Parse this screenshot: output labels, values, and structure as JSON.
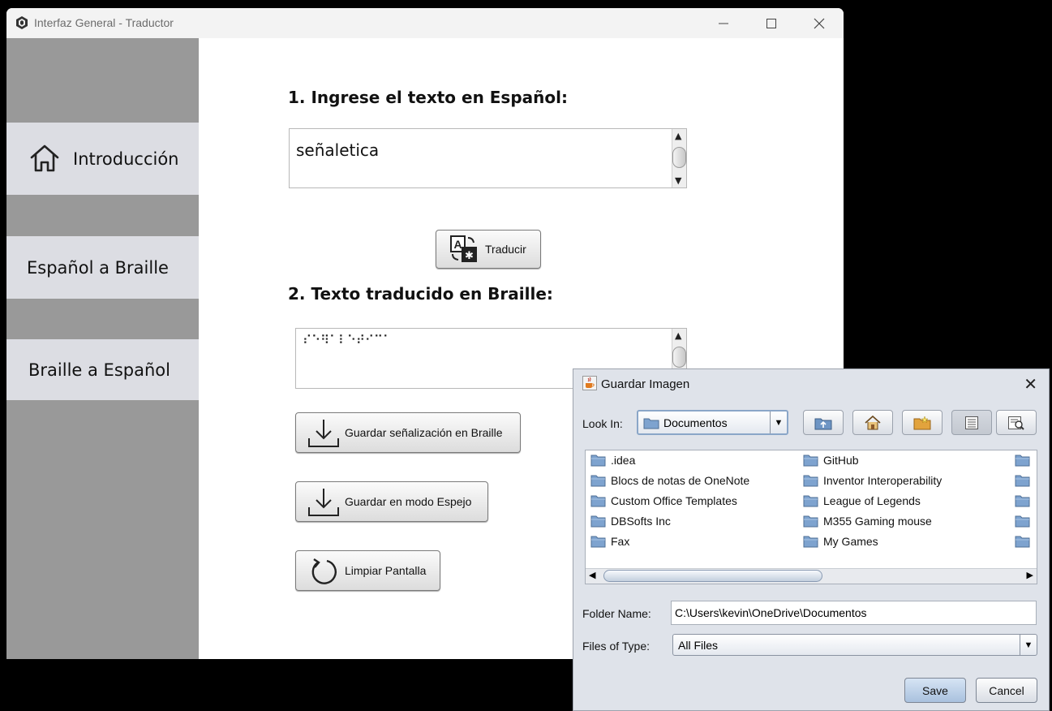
{
  "window": {
    "title": "Interfaz General - Traductor",
    "controls": [
      "minimize-icon",
      "maximize-icon",
      "close-icon"
    ]
  },
  "sidebar": {
    "items": [
      {
        "label": "Introducción",
        "icon": "home-icon"
      },
      {
        "label": "Español a Braille"
      },
      {
        "label": "Braille a Español"
      }
    ]
  },
  "main": {
    "heading1": "1. Ingrese el texto en Español:",
    "input_text": "señaletica",
    "translate_label": "Traducir",
    "heading2": "2. Texto traducido en Braille:",
    "braille_output": "⠎⠑⠻⠁⠇⠑⠞⠊⠉⠁",
    "save_braille_label": "Guardar señalización en Braille",
    "save_mirror_label": "Guardar en modo Espejo",
    "clear_label": "Limpiar Pantalla"
  },
  "dialog": {
    "title": "Guardar Imagen",
    "look_in_label": "Look In:",
    "look_in_value": "Documentos",
    "files_col1": [
      ".idea",
      "Blocs de notas de OneNote",
      "Custom Office Templates",
      "DBSofts Inc",
      "Fax"
    ],
    "files_col2": [
      "GitHub",
      "Inventor Interoperability",
      "League of Legends",
      "M355 Gaming mouse",
      "My Games"
    ],
    "folder_name_label": "Folder Name:",
    "folder_name_value": "C:\\Users\\kevin\\OneDrive\\Documentos",
    "files_of_type_label": "Files of Type:",
    "files_of_type_value": "All Files",
    "save_label": "Save",
    "cancel_label": "Cancel"
  },
  "colors": {
    "sidebar_bg": "#999999",
    "sidebar_item_bg": "#dcdde3",
    "dialog_bg": "#dfe3ea",
    "save_button": "#b9cde6"
  }
}
